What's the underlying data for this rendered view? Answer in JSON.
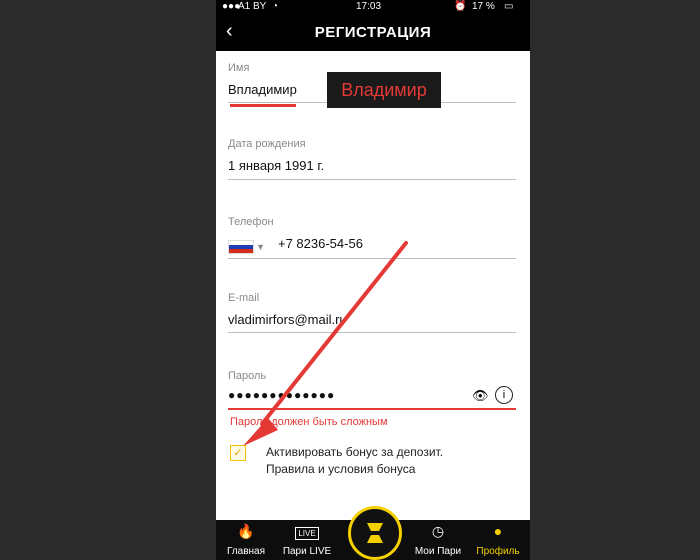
{
  "status": {
    "carrier": "A1 BY",
    "time": "17:03",
    "battery": "17 %"
  },
  "header": {
    "title": "РЕГИСТРАЦИЯ",
    "back_icon": "chevron-left-icon"
  },
  "callout": {
    "text": "Владимир"
  },
  "form": {
    "name": {
      "label": "Имя",
      "value": "Впладимир"
    },
    "birth": {
      "label": "Дата рождения",
      "value": "1 января 1991 г."
    },
    "phone": {
      "label": "Телефон",
      "value": "+7 8236-54-56"
    },
    "email": {
      "label": "E-mail",
      "value": "vladimirfors@mail.ru"
    },
    "password": {
      "label": "Пароль",
      "value": "●●●●●●●●●●●●●",
      "error": "Пароль должен быть сложным"
    }
  },
  "bonus": {
    "line1": "Активировать бонус за депозит.",
    "line2": "Правила и условия бонуса",
    "checked": true
  },
  "tabs": [
    {
      "label": "Главная",
      "icon": "flame-icon"
    },
    {
      "label": "Пари LIVE",
      "icon": "live-icon",
      "badge": "LIVE"
    },
    {
      "label": "Мои Пари",
      "icon": "clock-icon"
    },
    {
      "label": "Профиль",
      "icon": "user-icon",
      "active": true
    }
  ],
  "colors": {
    "accent": "#f5d000",
    "error": "#e53935",
    "topbar": "#000000"
  }
}
